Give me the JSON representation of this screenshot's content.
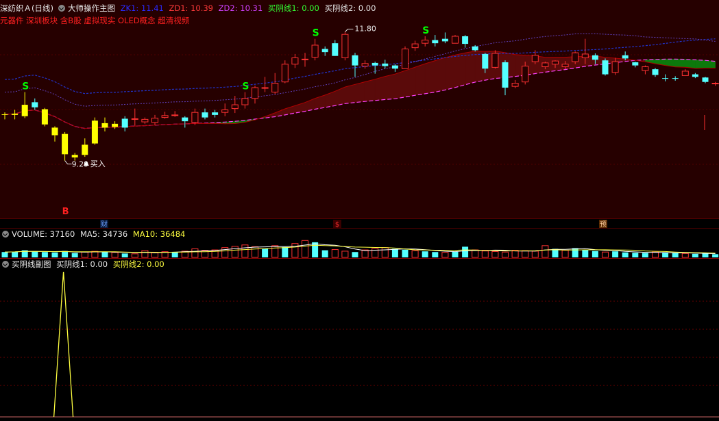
{
  "header": {
    "stock_name": "深纺织Ａ(日线)",
    "main_indicator": "大师操作主图",
    "zk1_label": "ZK1: 11.41",
    "zd1_label": "ZD1: 10.39",
    "zd2_label": "ZD2: 10.31",
    "buy1_label": "买阴线1: 0.00",
    "buy2_label": "买阴线2: 0.00",
    "concepts": "元器件 深圳板块 含B股 虚拟现实 OLED概念 超清视频"
  },
  "volume_header": {
    "title": "VOLUME: 37160",
    "ma5": "MA5: 34736",
    "ma10": "MA10: 36484"
  },
  "sub_header": {
    "title": "买阴线副图",
    "line1": "买阴线1: 0.00",
    "line2": "买阴线2: 0.00"
  },
  "annotations": {
    "high_label": "11.80",
    "low_label": "9.29",
    "buy_text": "买入",
    "b_marker": "B",
    "s_marker": "S",
    "event_cai": "财",
    "event_dollar": "$",
    "event_yu": "预"
  },
  "colors": {
    "up": "#ff3232",
    "down": "#54ffff",
    "signal_yellow": "#ffff00",
    "green_band": "#0c7a0c",
    "red_band": "#5a0a0a",
    "panel_bg": "#260000",
    "grid": "#7a0000",
    "s_green": "#00ff00"
  },
  "chart_data": {
    "type": "candlestick",
    "price_range": [
      9.0,
      12.0
    ],
    "candles": [
      {
        "o": 10.62,
        "c": 10.63,
        "h": 10.66,
        "l": 10.55,
        "color": "yellow"
      },
      {
        "o": 10.62,
        "c": 10.64,
        "h": 10.7,
        "l": 10.55,
        "color": "yellow"
      },
      {
        "o": 10.6,
        "c": 10.78,
        "h": 10.98,
        "l": 10.57,
        "color": "yellow"
      },
      {
        "o": 10.82,
        "c": 10.74,
        "h": 10.88,
        "l": 10.7,
        "color": "down"
      },
      {
        "o": 10.71,
        "c": 10.47,
        "h": 10.73,
        "l": 10.44,
        "color": "yellow"
      },
      {
        "o": 10.42,
        "c": 10.3,
        "h": 10.44,
        "l": 10.2,
        "color": "yellow"
      },
      {
        "o": 10.32,
        "c": 10.0,
        "h": 10.35,
        "l": 9.9,
        "color": "yellow"
      },
      {
        "o": 9.99,
        "c": 9.95,
        "h": 10.02,
        "l": 9.9,
        "color": "yellow"
      },
      {
        "o": 9.99,
        "c": 10.15,
        "h": 10.25,
        "l": 9.96,
        "color": "yellow"
      },
      {
        "o": 10.17,
        "c": 10.53,
        "h": 10.58,
        "l": 10.15,
        "color": "yellow"
      },
      {
        "o": 10.42,
        "c": 10.49,
        "h": 10.58,
        "l": 10.36,
        "color": "yellow"
      },
      {
        "o": 10.48,
        "c": 10.43,
        "h": 10.52,
        "l": 10.4,
        "color": "yellow"
      },
      {
        "o": 10.42,
        "c": 10.56,
        "h": 10.6,
        "l": 10.36,
        "color": "down"
      },
      {
        "o": 10.56,
        "c": 10.55,
        "h": 10.72,
        "l": 10.45,
        "color": "up"
      },
      {
        "o": 10.51,
        "c": 10.55,
        "h": 10.58,
        "l": 10.48,
        "color": "up"
      },
      {
        "o": 10.5,
        "c": 10.57,
        "h": 10.62,
        "l": 10.46,
        "color": "up"
      },
      {
        "o": 10.58,
        "c": 10.61,
        "h": 10.67,
        "l": 10.56,
        "color": "up"
      },
      {
        "o": 10.62,
        "c": 10.61,
        "h": 10.68,
        "l": 10.59,
        "color": "up"
      },
      {
        "o": 10.58,
        "c": 10.52,
        "h": 10.6,
        "l": 10.42,
        "color": "down"
      },
      {
        "o": 10.5,
        "c": 10.66,
        "h": 10.72,
        "l": 10.46,
        "color": "up"
      },
      {
        "o": 10.66,
        "c": 10.58,
        "h": 10.72,
        "l": 10.55,
        "color": "down"
      },
      {
        "o": 10.62,
        "c": 10.66,
        "h": 10.7,
        "l": 10.58,
        "color": "down"
      },
      {
        "o": 10.66,
        "c": 10.7,
        "h": 10.8,
        "l": 10.6,
        "color": "up"
      },
      {
        "o": 10.72,
        "c": 10.78,
        "h": 10.92,
        "l": 10.65,
        "color": "up"
      },
      {
        "o": 10.78,
        "c": 10.88,
        "h": 10.98,
        "l": 10.72,
        "color": "up"
      },
      {
        "o": 10.88,
        "c": 11.05,
        "h": 11.08,
        "l": 10.8,
        "color": "up"
      },
      {
        "o": 11.05,
        "c": 11.05,
        "h": 11.22,
        "l": 10.98,
        "color": "up"
      },
      {
        "o": 10.98,
        "c": 11.12,
        "h": 11.28,
        "l": 10.95,
        "color": "up"
      },
      {
        "o": 11.14,
        "c": 11.42,
        "h": 11.48,
        "l": 11.12,
        "color": "up"
      },
      {
        "o": 11.42,
        "c": 11.52,
        "h": 11.58,
        "l": 11.36,
        "color": "up"
      },
      {
        "o": 11.5,
        "c": 11.5,
        "h": 11.6,
        "l": 11.38,
        "color": "up"
      },
      {
        "o": 11.53,
        "c": 11.72,
        "h": 11.82,
        "l": 11.48,
        "color": "up"
      },
      {
        "o": 11.66,
        "c": 11.61,
        "h": 11.7,
        "l": 11.55,
        "color": "down"
      },
      {
        "o": 11.55,
        "c": 11.75,
        "h": 11.8,
        "l": 11.55,
        "color": "down"
      },
      {
        "o": 11.52,
        "c": 11.89,
        "h": 11.93,
        "l": 11.48,
        "color": "up"
      },
      {
        "o": 11.56,
        "c": 11.4,
        "h": 11.6,
        "l": 11.22,
        "color": "down"
      },
      {
        "o": 11.39,
        "c": 11.43,
        "h": 11.48,
        "l": 11.35,
        "color": "up"
      },
      {
        "o": 11.44,
        "c": 11.4,
        "h": 11.46,
        "l": 11.27,
        "color": "down"
      },
      {
        "o": 11.39,
        "c": 11.43,
        "h": 11.49,
        "l": 11.35,
        "color": "down"
      },
      {
        "o": 11.35,
        "c": 11.4,
        "h": 11.42,
        "l": 11.3,
        "color": "down"
      },
      {
        "o": 11.35,
        "c": 11.66,
        "h": 11.7,
        "l": 11.35,
        "color": "up"
      },
      {
        "o": 11.68,
        "c": 11.74,
        "h": 11.79,
        "l": 11.63,
        "color": "up"
      },
      {
        "o": 11.75,
        "c": 11.8,
        "h": 11.86,
        "l": 11.7,
        "color": "up"
      },
      {
        "o": 11.8,
        "c": 11.75,
        "h": 11.88,
        "l": 11.7,
        "color": "down"
      },
      {
        "o": 11.78,
        "c": 11.82,
        "h": 11.92,
        "l": 11.75,
        "color": "down"
      },
      {
        "o": 11.75,
        "c": 11.86,
        "h": 11.88,
        "l": 11.75,
        "color": "up"
      },
      {
        "o": 11.86,
        "c": 11.74,
        "h": 11.88,
        "l": 11.68,
        "color": "down"
      },
      {
        "o": 11.7,
        "c": 11.64,
        "h": 11.72,
        "l": 11.62,
        "color": "down"
      },
      {
        "o": 11.58,
        "c": 11.35,
        "h": 11.6,
        "l": 11.28,
        "color": "down"
      },
      {
        "o": 11.37,
        "c": 11.59,
        "h": 11.64,
        "l": 11.35,
        "color": "up"
      },
      {
        "o": 11.45,
        "c": 11.05,
        "h": 11.48,
        "l": 10.93,
        "color": "down"
      },
      {
        "o": 11.07,
        "c": 11.12,
        "h": 11.17,
        "l": 11.04,
        "color": "up"
      },
      {
        "o": 11.14,
        "c": 11.39,
        "h": 11.46,
        "l": 11.1,
        "color": "up"
      },
      {
        "o": 11.46,
        "c": 11.56,
        "h": 11.64,
        "l": 11.42,
        "color": "up"
      },
      {
        "o": 11.38,
        "c": 11.44,
        "h": 11.46,
        "l": 11.34,
        "color": "up"
      },
      {
        "o": 11.47,
        "c": 11.42,
        "h": 11.48,
        "l": 11.36,
        "color": "up"
      },
      {
        "o": 11.38,
        "c": 11.42,
        "h": 11.47,
        "l": 11.34,
        "color": "up"
      },
      {
        "o": 11.46,
        "c": 11.6,
        "h": 11.62,
        "l": 11.42,
        "color": "up"
      },
      {
        "o": 11.58,
        "c": 11.52,
        "h": 11.82,
        "l": 11.42,
        "color": "up"
      },
      {
        "o": 11.56,
        "c": 11.49,
        "h": 11.59,
        "l": 11.42,
        "color": "down"
      },
      {
        "o": 11.48,
        "c": 11.26,
        "h": 11.51,
        "l": 11.24,
        "color": "down"
      },
      {
        "o": 11.29,
        "c": 11.46,
        "h": 11.52,
        "l": 11.25,
        "color": "up"
      },
      {
        "o": 11.56,
        "c": 11.51,
        "h": 11.62,
        "l": 11.48,
        "color": "down"
      },
      {
        "o": 11.45,
        "c": 11.4,
        "h": 11.46,
        "l": 11.37,
        "color": "down"
      },
      {
        "o": 11.38,
        "c": 11.32,
        "h": 11.4,
        "l": 11.26,
        "color": "up"
      },
      {
        "o": 11.34,
        "c": 11.25,
        "h": 11.36,
        "l": 11.22,
        "color": "down"
      },
      {
        "o": 11.2,
        "c": 11.2,
        "h": 11.26,
        "l": 11.15,
        "color": "down"
      },
      {
        "o": 11.2,
        "c": 11.2,
        "h": 11.23,
        "l": 11.16,
        "color": "down"
      },
      {
        "o": 11.31,
        "c": 11.24,
        "h": 11.34,
        "l": 11.24,
        "color": "up"
      },
      {
        "o": 11.26,
        "c": 11.22,
        "h": 11.28,
        "l": 11.2,
        "color": "down"
      },
      {
        "o": 11.21,
        "c": 11.14,
        "h": 11.22,
        "l": 11.12,
        "color": "down"
      },
      {
        "o": 11.12,
        "c": 11.11,
        "h": 11.14,
        "l": 11.08,
        "color": "up"
      }
    ],
    "volume": [
      {
        "v": 0.3,
        "up": false
      },
      {
        "v": 0.32,
        "up": false
      },
      {
        "v": 0.4,
        "up": false
      },
      {
        "v": 0.33,
        "up": false
      },
      {
        "v": 0.3,
        "up": false
      },
      {
        "v": 0.28,
        "up": false
      },
      {
        "v": 0.36,
        "up": false
      },
      {
        "v": 0.25,
        "up": false
      },
      {
        "v": 0.3,
        "up": true
      },
      {
        "v": 0.34,
        "up": true
      },
      {
        "v": 0.31,
        "up": false
      },
      {
        "v": 0.28,
        "up": true
      },
      {
        "v": 0.22,
        "up": false
      },
      {
        "v": 0.2,
        "up": true
      },
      {
        "v": 0.38,
        "up": true
      },
      {
        "v": 0.26,
        "up": true
      },
      {
        "v": 0.32,
        "up": true
      },
      {
        "v": 0.3,
        "up": false
      },
      {
        "v": 0.35,
        "up": true
      },
      {
        "v": 0.48,
        "up": true
      },
      {
        "v": 0.4,
        "up": true
      },
      {
        "v": 0.42,
        "up": true
      },
      {
        "v": 0.55,
        "up": true
      },
      {
        "v": 0.62,
        "up": true
      },
      {
        "v": 0.7,
        "up": true
      },
      {
        "v": 0.6,
        "up": true
      },
      {
        "v": 0.5,
        "up": false
      },
      {
        "v": 0.66,
        "up": true
      },
      {
        "v": 0.58,
        "up": false
      },
      {
        "v": 0.78,
        "up": true
      },
      {
        "v": 0.95,
        "up": true
      },
      {
        "v": 0.85,
        "up": false
      },
      {
        "v": 0.4,
        "up": false
      },
      {
        "v": 0.44,
        "up": true
      },
      {
        "v": 0.35,
        "up": true
      },
      {
        "v": 0.3,
        "up": false
      },
      {
        "v": 0.42,
        "up": true
      },
      {
        "v": 0.5,
        "up": true
      },
      {
        "v": 0.55,
        "up": true
      },
      {
        "v": 0.48,
        "up": false
      },
      {
        "v": 0.43,
        "up": false
      },
      {
        "v": 0.38,
        "up": true
      },
      {
        "v": 0.34,
        "up": false
      },
      {
        "v": 0.3,
        "up": false
      },
      {
        "v": 0.28,
        "up": true
      },
      {
        "v": 0.32,
        "up": false
      },
      {
        "v": 0.6,
        "up": false
      },
      {
        "v": 0.42,
        "up": true
      },
      {
        "v": 0.36,
        "up": true
      },
      {
        "v": 0.33,
        "up": true
      },
      {
        "v": 0.3,
        "up": true
      },
      {
        "v": 0.4,
        "up": true
      },
      {
        "v": 0.38,
        "up": true
      },
      {
        "v": 0.35,
        "up": true
      },
      {
        "v": 0.66,
        "up": true
      },
      {
        "v": 0.48,
        "up": false
      },
      {
        "v": 0.4,
        "up": true
      },
      {
        "v": 0.52,
        "up": false
      },
      {
        "v": 0.42,
        "up": false
      },
      {
        "v": 0.36,
        "up": false
      },
      {
        "v": 0.3,
        "up": true
      },
      {
        "v": 0.34,
        "up": false
      },
      {
        "v": 0.28,
        "up": false
      },
      {
        "v": 0.26,
        "up": false
      },
      {
        "v": 0.25,
        "up": false
      },
      {
        "v": 0.3,
        "up": true
      },
      {
        "v": 0.26,
        "up": false
      },
      {
        "v": 0.24,
        "up": false
      },
      {
        "v": 0.22,
        "up": true
      },
      {
        "v": 0.2,
        "up": false
      },
      {
        "v": 0.22,
        "up": false
      },
      {
        "v": 0.18,
        "up": false
      }
    ],
    "sub_spike": {
      "index": 6,
      "value": 1.0
    }
  }
}
